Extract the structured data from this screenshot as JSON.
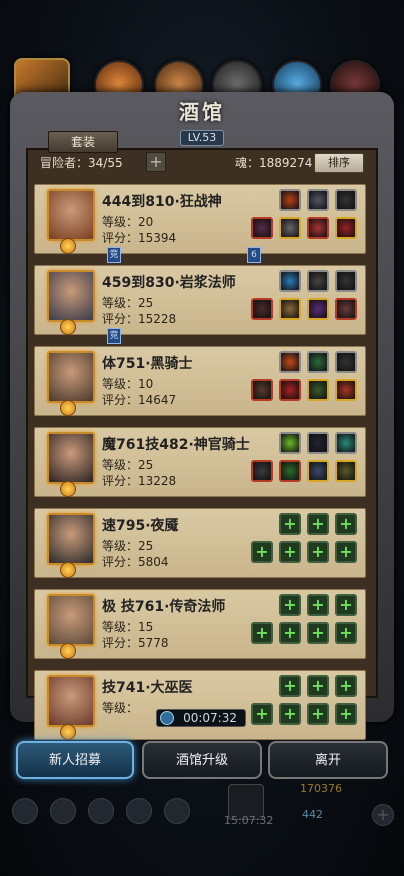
{
  "top_bar": {
    "heroes": [
      "hero-a",
      "hero-b",
      "hero-c",
      "hero-d",
      "hero-e",
      "hero-f"
    ]
  },
  "tavern": {
    "title": "酒馆",
    "level": "LV.53",
    "suit_button": "套装",
    "adventurer_label": "冒险者：34/55",
    "soul_label": "魂：1889274",
    "sort_button": "排序"
  },
  "heroes": [
    {
      "name": "444到810·狂战神",
      "level": "等级：20",
      "score": "评分：15394",
      "flags": [
        "竞",
        "6"
      ]
    },
    {
      "name": "459到830·岩浆法师",
      "level": "等级：25",
      "score": "评分：15228",
      "flags": [
        "竞"
      ]
    },
    {
      "name": "体751·黑骑士",
      "level": "等级：10",
      "score": "评分：14647",
      "flags": []
    },
    {
      "name": "魔761技482·神官骑士",
      "level": "等级：25",
      "score": "评分：13228",
      "flags": []
    },
    {
      "name": "速795·夜魇",
      "level": "等级：25",
      "score": "评分：5804",
      "flags": []
    },
    {
      "name": "极 技761·传奇法师",
      "level": "等级：15",
      "score": "评分：5778",
      "flags": []
    },
    {
      "name": "技741·大巫医",
      "level": "等级：",
      "score": "",
      "flags": []
    }
  ],
  "timer": "00:07:32",
  "buttons": {
    "recruit": "新人招募",
    "upgrade": "酒馆升级",
    "leave": "离开"
  },
  "background": {
    "gold": "170376",
    "time": "15:07:32",
    "gem": "442"
  }
}
